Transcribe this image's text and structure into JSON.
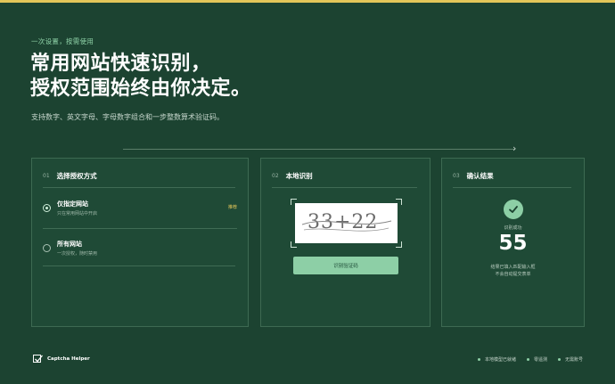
{
  "hero": {
    "eyebrow": "一次设置，按需使用",
    "headline_line1": "常用网站快速识别，",
    "headline_line2": "授权范围始终由你决定。",
    "subtitle": "支持数字、英文字母、字母数字组合和一步整数算术验证码。"
  },
  "steps": [
    {
      "number": "01",
      "title": "选择授权方式",
      "options": [
        {
          "title": "仅指定网站",
          "desc": "只在常用网站中开启",
          "badge": "推荐",
          "selected": true
        },
        {
          "title": "所有网站",
          "desc": "一次授权，随时禁用",
          "selected": false
        }
      ]
    },
    {
      "number": "02",
      "title": "本地识别",
      "captcha_text": "33+22",
      "button_label": "识别验证码"
    },
    {
      "number": "03",
      "title": "确认结果",
      "status_label": "识别成功",
      "result_value": "55",
      "note_line1": "结果已填入匹配输入框",
      "note_line2": "不会自动提交表单"
    }
  ],
  "footer": {
    "brand": "Captcha Helper",
    "status": [
      "本地模型已就绪",
      "零遥测",
      "无需账号"
    ]
  },
  "colors": {
    "background": "#1c4331",
    "card": "#1f4a36",
    "accent_green": "#8dcfa6",
    "accent_yellow": "#e3c659"
  }
}
